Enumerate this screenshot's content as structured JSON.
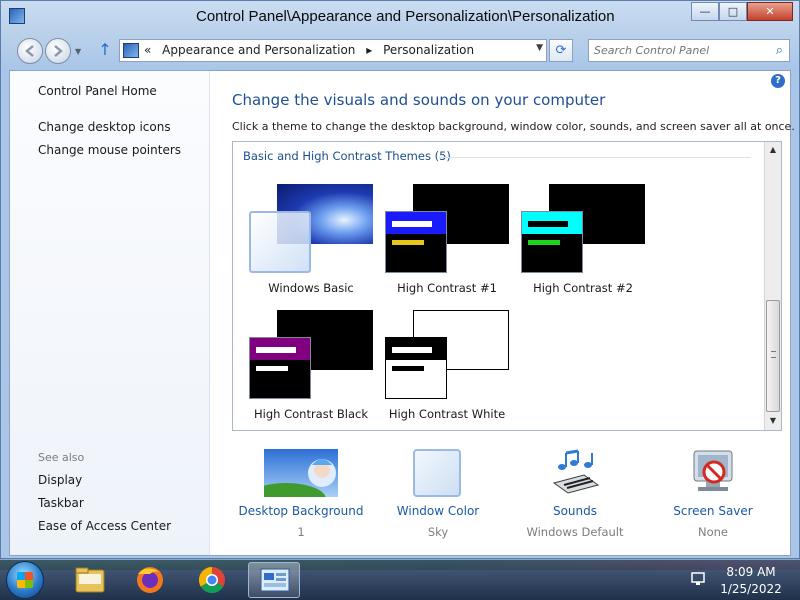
{
  "window": {
    "title": "Control Panel\\Appearance and Personalization\\Personalization",
    "buttons": {
      "minimize": "—",
      "maximize": "□",
      "close": "✕"
    }
  },
  "navbar": {
    "back_icon": "back-arrow-icon",
    "forward_icon": "forward-arrow-icon",
    "up_icon": "↑",
    "breadcrumb_sep": "«",
    "crumbs": [
      "Appearance and Personalization",
      "▸",
      "Personalization"
    ],
    "dropdown": "▼",
    "refresh": "⟳",
    "search_placeholder": "Search Control Panel",
    "search_icon": "⌕"
  },
  "sidebar": {
    "items": [
      "Control Panel Home",
      "Change desktop icons",
      "Change mouse pointers"
    ],
    "see_also_label": "See also",
    "see_also": [
      "Display",
      "Taskbar",
      "Ease of Access Center"
    ]
  },
  "main": {
    "help_icon": "?",
    "heading": "Change the visuals and sounds on your computer",
    "subtext": "Click a theme to change the desktop background, window color, sounds, and screen saver all at once.",
    "group_title": "Basic and High Contrast Themes (5)",
    "themes": [
      {
        "name": "Windows Basic",
        "selected": true
      },
      {
        "name": "High Contrast #1",
        "selected": false
      },
      {
        "name": "High Contrast #2",
        "selected": false
      },
      {
        "name": "High Contrast Black",
        "selected": false
      },
      {
        "name": "High Contrast White",
        "selected": false
      }
    ],
    "scroll_up": "▲",
    "scroll_down": "▼"
  },
  "bottom": [
    {
      "label": "Desktop Background",
      "value": "1"
    },
    {
      "label": "Window Color",
      "value": "Sky"
    },
    {
      "label": "Sounds",
      "value": "Windows Default"
    },
    {
      "label": "Screen Saver",
      "value": "None"
    }
  ],
  "taskbar": {
    "pinned": [
      "explorer-folder-icon",
      "firefox-icon",
      "chrome-icon",
      "control-panel-icon"
    ],
    "tray_icon": "network-icon",
    "time": "8:09 AM",
    "date": "1/25/2022"
  },
  "colors": {
    "heading": "#1f4f94",
    "link": "#1c5aa4",
    "hc1_title": "#1a1aff",
    "hc2_title": "#00ffff",
    "hc_black_title": "#800080"
  }
}
